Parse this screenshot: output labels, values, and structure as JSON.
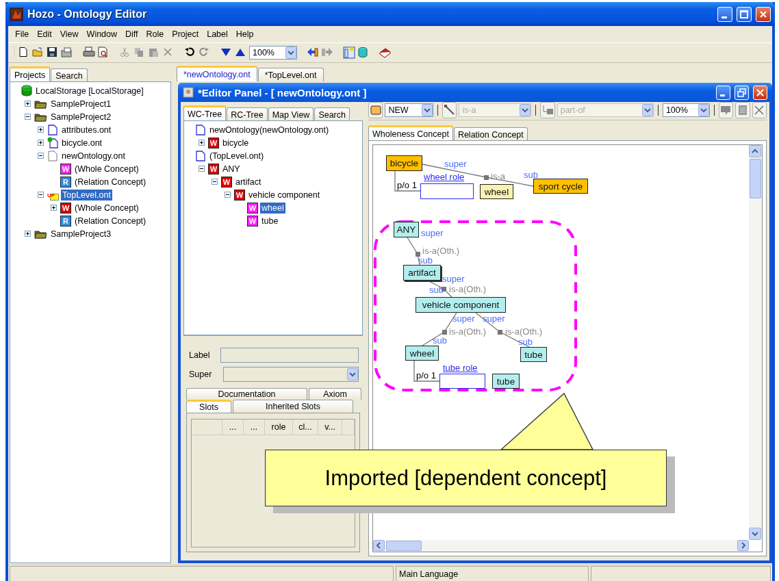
{
  "window": {
    "title": "Hozo - Ontology Editor"
  },
  "menu": [
    "File",
    "Edit",
    "View",
    "Window",
    "Diff",
    "Role",
    "Project",
    "Label",
    "Help"
  ],
  "toolbar": {
    "zoom": "100%"
  },
  "left_panel": {
    "tabs": [
      {
        "label": "Projects",
        "selected": true
      },
      {
        "label": "Search",
        "selected": false
      }
    ],
    "tree": [
      {
        "label": "LocalStorage [LocalStorage]",
        "kind": "storage",
        "selected": false,
        "children": [
          {
            "label": "SampleProject1",
            "kind": "project",
            "expanded": false,
            "selected": false
          },
          {
            "label": "SampleProject2",
            "kind": "project",
            "expanded": true,
            "selected": false,
            "children": [
              {
                "label": "attributes.ont",
                "kind": "file",
                "expanded": false,
                "selected": false
              },
              {
                "label": "bicycle.ont",
                "kind": "file-shared",
                "expanded": false,
                "selected": false
              },
              {
                "label": "newOntology.ont",
                "kind": "file-plain",
                "expanded": true,
                "selected": false,
                "children": [
                  {
                    "label": "(Whole Concept)",
                    "kind": "whole-imported",
                    "badge": "W",
                    "selected": false
                  },
                  {
                    "label": "(Relation Concept)",
                    "kind": "relation",
                    "badge": "R",
                    "selected": false
                  }
                ]
              },
              {
                "label": "TopLevel.ont",
                "kind": "toplevel",
                "badge": "UP",
                "expanded": true,
                "selected": true,
                "children": [
                  {
                    "label": "(Whole Concept)",
                    "kind": "whole",
                    "badge": "W",
                    "expanded": false,
                    "selected": false
                  },
                  {
                    "label": "(Relation Concept)",
                    "kind": "relation",
                    "badge": "R",
                    "selected": false
                  }
                ]
              }
            ]
          },
          {
            "label": "SampleProject3",
            "kind": "project",
            "expanded": false,
            "selected": false
          }
        ]
      }
    ]
  },
  "document_tabs": [
    {
      "label": "*newOntology.ont",
      "selected": true
    },
    {
      "label": "*TopLevel.ont",
      "selected": false
    }
  ],
  "editor_panel": {
    "title": "*Editor Panel - [ newOntology.ont ]",
    "tree_tabs": [
      {
        "label": "WC-Tree",
        "selected": true
      },
      {
        "label": "RC-Tree",
        "selected": false
      },
      {
        "label": "Map View",
        "selected": false
      },
      {
        "label": "Search",
        "selected": false
      }
    ],
    "tree": [
      {
        "label": "newOntology(newOntology.ont)",
        "kind": "file",
        "selected": false,
        "children": [
          {
            "label": "bicycle",
            "kind": "whole",
            "badge": "W",
            "expanded": false,
            "selected": false
          }
        ]
      },
      {
        "label": "(TopLevel.ont)",
        "kind": "file",
        "selected": false,
        "children": [
          {
            "label": "ANY",
            "kind": "whole",
            "badge": "W",
            "expanded": true,
            "selected": false,
            "children": [
              {
                "label": "artifact",
                "kind": "whole",
                "badge": "W",
                "expanded": true,
                "selected": false,
                "children": [
                  {
                    "label": "vehicle component",
                    "kind": "whole",
                    "badge": "W",
                    "expanded": true,
                    "selected": false,
                    "children": [
                      {
                        "label": "wheel",
                        "kind": "whole-imported",
                        "badge": "W",
                        "selected": true
                      },
                      {
                        "label": "tube",
                        "kind": "whole-imported",
                        "badge": "W",
                        "selected": false
                      }
                    ]
                  }
                ]
              }
            ]
          }
        ]
      }
    ],
    "fields": [
      {
        "label": "Label",
        "kind": "text"
      },
      {
        "label": "Super",
        "kind": "combo"
      }
    ],
    "detail_tabs": [
      {
        "label": "Documentation",
        "selected": false
      },
      {
        "label": "Axiom",
        "selected": false
      },
      {
        "label": "Slots",
        "selected": true
      },
      {
        "label": "Inherited Slots",
        "selected": false
      }
    ],
    "slot_columns": [
      "...",
      "...",
      "role",
      "cl...",
      "v..."
    ],
    "diagram_toolbar": {
      "node_type": {
        "value": "NEW",
        "disabled": false
      },
      "link_type": {
        "value": "is-a",
        "disabled": true
      },
      "part_type": {
        "value": "part-of",
        "disabled": true
      },
      "zoom": {
        "value": "100%",
        "disabled": false
      }
    },
    "view_tabs": [
      {
        "label": "Wholeness Concept",
        "selected": true
      },
      {
        "label": "Relation Concept",
        "selected": false
      }
    ],
    "diagram": {
      "nodes": [
        {
          "label": "bicycle",
          "kind": "concept"
        },
        {
          "kind": "role-slot"
        },
        {
          "label": "wheel",
          "kind": "class-constraint"
        },
        {
          "label": "sport cycle",
          "kind": "concept"
        },
        {
          "label": "ANY",
          "kind": "imported"
        },
        {
          "label": "artifact",
          "kind": "imported"
        },
        {
          "label": "vehicle component",
          "kind": "imported"
        },
        {
          "label": "wheel",
          "kind": "imported"
        },
        {
          "label": "tube",
          "kind": "imported"
        },
        {
          "kind": "role-slot"
        },
        {
          "label": "tube",
          "kind": "imported"
        }
      ],
      "labels": [
        {
          "text": "super",
          "kind": "end"
        },
        {
          "text": "wheel role",
          "kind": "role"
        },
        {
          "text": "is-a",
          "kind": "relation"
        },
        {
          "text": "sub",
          "kind": "end"
        },
        {
          "text": "p/o 1",
          "kind": "cardinality"
        },
        {
          "text": "super",
          "kind": "end"
        },
        {
          "text": "is-a(Oth.)",
          "kind": "relation"
        },
        {
          "text": "sub",
          "kind": "end"
        },
        {
          "text": "super",
          "kind": "end"
        },
        {
          "text": "sub",
          "kind": "end"
        },
        {
          "text": "is-a(Oth.)",
          "kind": "relation"
        },
        {
          "text": "super",
          "kind": "end"
        },
        {
          "text": "super",
          "kind": "end"
        },
        {
          "text": "is-a(Oth.)",
          "kind": "relation"
        },
        {
          "text": "is-a(Oth.)",
          "kind": "relation"
        },
        {
          "text": "sub",
          "kind": "end"
        },
        {
          "text": "sub",
          "kind": "end"
        },
        {
          "text": "tube role",
          "kind": "role"
        },
        {
          "text": "p/o 1",
          "kind": "cardinality"
        }
      ]
    }
  },
  "callout": {
    "text": "Imported [dependent concept]"
  },
  "status_bar": {
    "language": "Main Language"
  }
}
